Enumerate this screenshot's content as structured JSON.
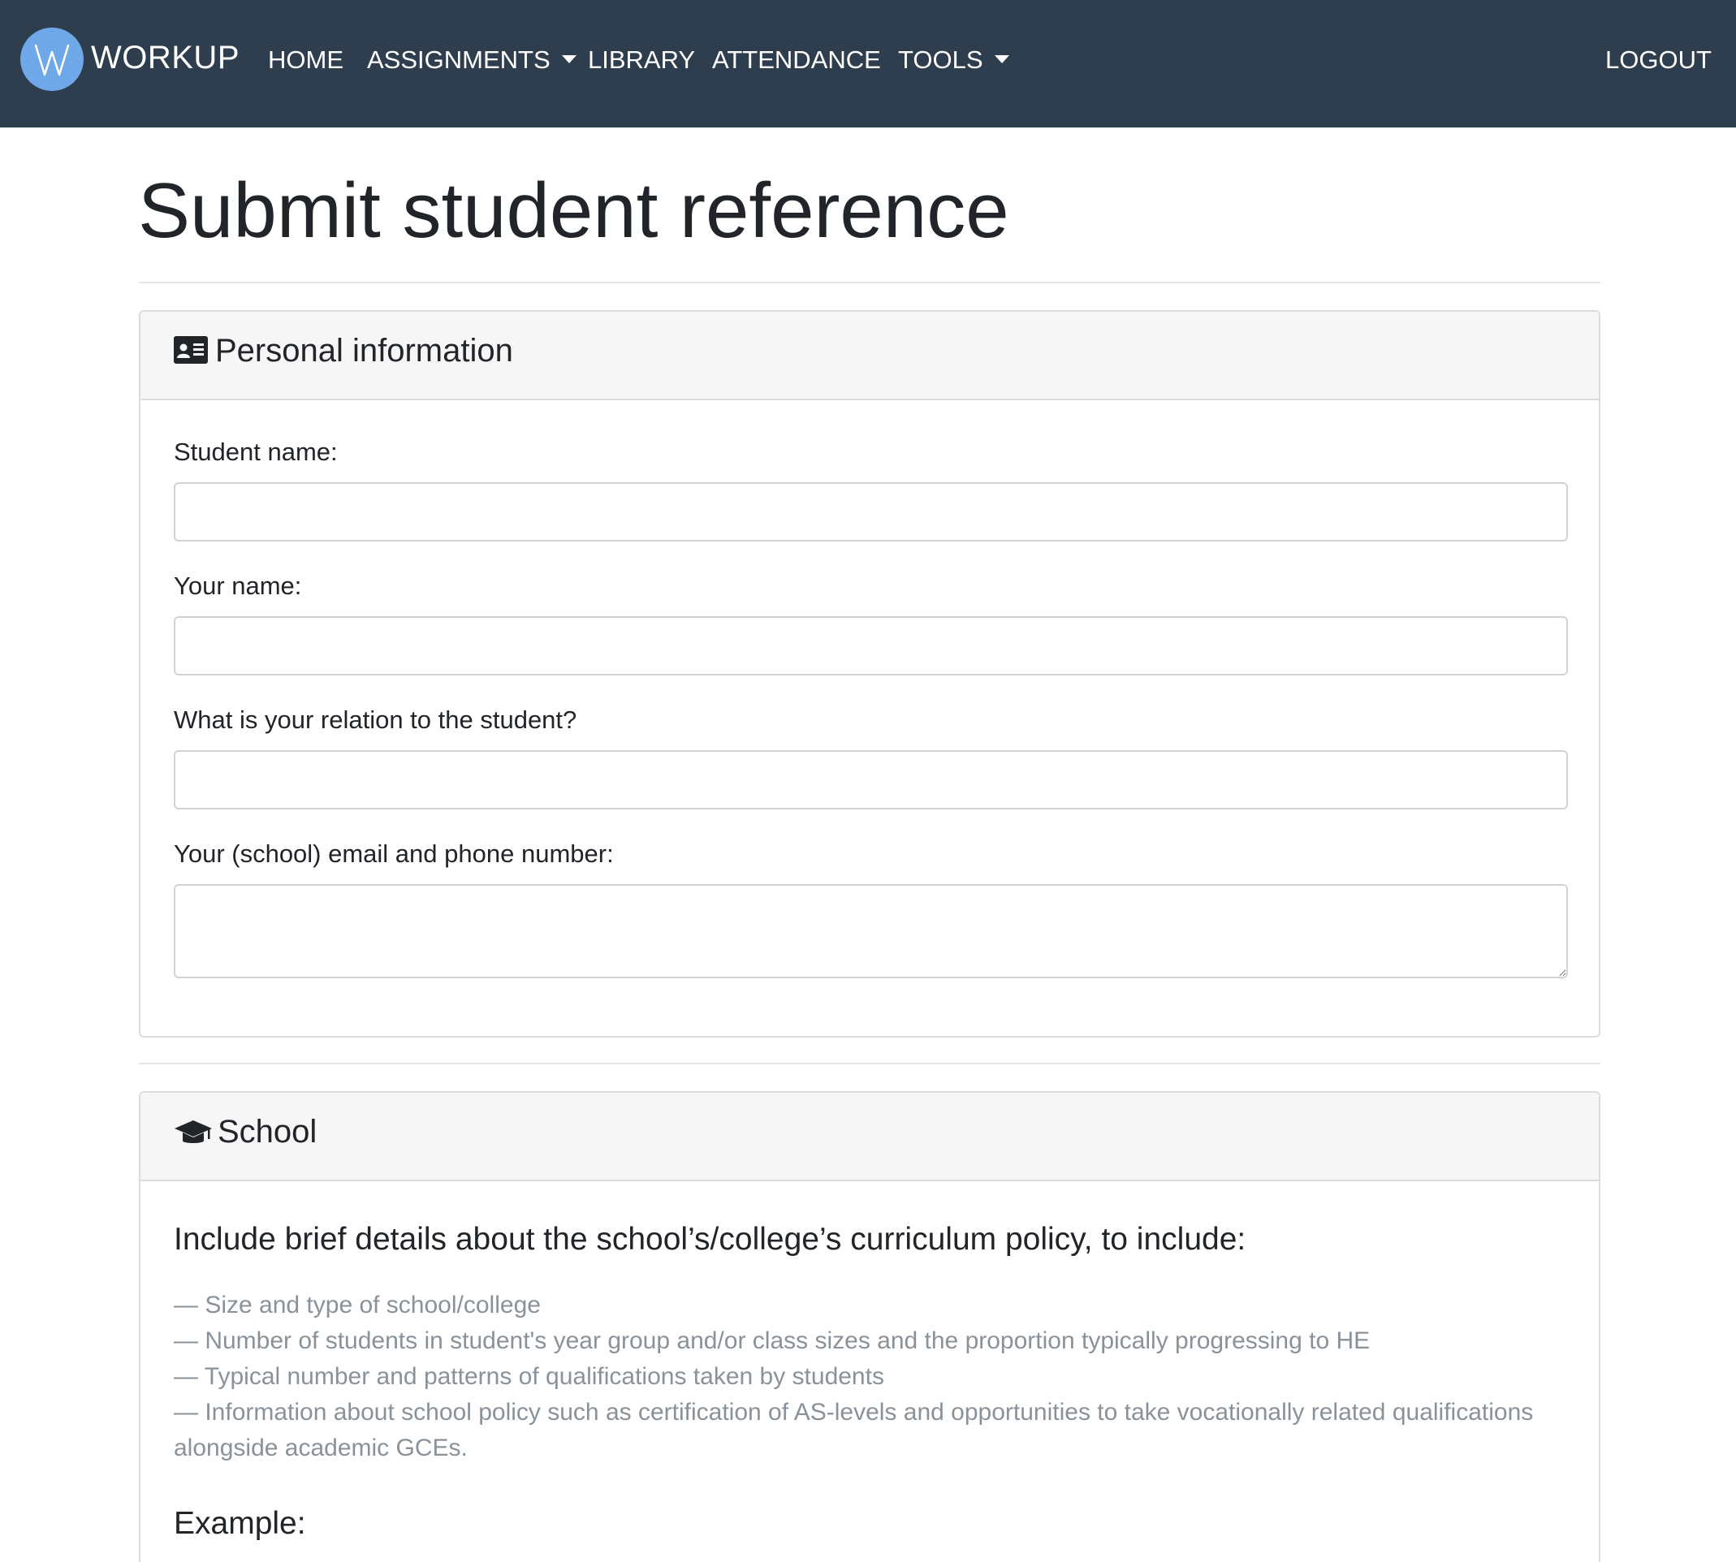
{
  "navbar": {
    "brand": "WORKUP",
    "items": [
      {
        "label": "HOME",
        "dropdown": false
      },
      {
        "label": "ASSIGNMENTS",
        "dropdown": true
      },
      {
        "label": "LIBRARY",
        "dropdown": false
      },
      {
        "label": "ATTENDANCE",
        "dropdown": false
      },
      {
        "label": "TOOLS",
        "dropdown": true
      }
    ],
    "logout": "LOGOUT"
  },
  "page": {
    "title": "Submit student reference"
  },
  "personal": {
    "title": "Personal information",
    "icon": "id-card-icon",
    "fields": [
      {
        "label": "Student name:",
        "value": ""
      },
      {
        "label": "Your name:",
        "value": ""
      },
      {
        "label": "What is your relation to the student?",
        "value": ""
      },
      {
        "label": "Your (school) email and phone number:",
        "value": ""
      }
    ]
  },
  "school": {
    "title": "School",
    "icon": "graduation-cap-icon",
    "heading": "Include brief details about the school’s/college’s curriculum policy, to include:",
    "guidelines": [
      "— Size and type of school/college",
      "— Number of students in student's year group and/or class sizes and the proportion typically progressing to HE",
      "— Typical number and patterns of qualifications taken by students",
      "— Information about school policy such as certification of AS-levels and opportunities to take vocationally related qualifications alongside academic GCEs."
    ],
    "example_heading": "Example:"
  },
  "colors": {
    "navbar": "#2f3e4f",
    "logo": "#6ea8e8",
    "muted_text": "#8a9299"
  }
}
